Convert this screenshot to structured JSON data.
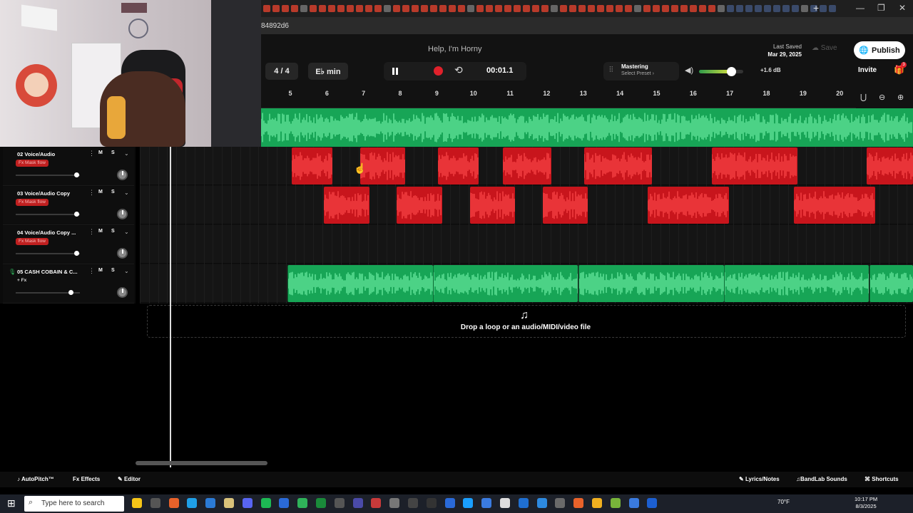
{
  "browser": {
    "url_fragment": "84892d6",
    "new_tab": "+",
    "window_controls": [
      "—",
      "❐",
      "✕"
    ]
  },
  "app": {
    "song_title": "Help, I'm Horny",
    "last_saved_label": "Last Saved",
    "last_saved_date": "Mar 29, 2025",
    "save_label": "Save",
    "publish_label": "Publish",
    "time_signature": "4 / 4",
    "key": "E♭ min",
    "time_display": "00:01.1",
    "mastering_label": "Mastering",
    "mastering_sub": "Select Preset ›",
    "volume_db": "+1.6 dB",
    "volume_level": 0.73,
    "invite_label": "Invite",
    "gift_badge": "3"
  },
  "ruler": {
    "bars": [
      "5",
      "6",
      "7",
      "8",
      "9",
      "10",
      "11",
      "12",
      "13",
      "14",
      "15",
      "16",
      "17",
      "18",
      "19",
      "20"
    ]
  },
  "tracks": [
    {
      "name": "02 Voice/Audio",
      "fx": "Fx  Mask flow",
      "mute": "M",
      "solo": "S",
      "volume": 0.95
    },
    {
      "name": "03 Voice/Audio Copy",
      "fx": "Fx  Mask flow",
      "mute": "M",
      "solo": "S",
      "volume": 0.95
    },
    {
      "name": "04 Voice/Audio Copy ...",
      "fx": "Fx  Mask flow",
      "mute": "M",
      "solo": "S",
      "volume": 0.95
    },
    {
      "name": "05 CASH COBAIN & C...",
      "fx": "+ Fx",
      "mute": "M",
      "solo": "S",
      "volume": 0.86
    }
  ],
  "dropzone": {
    "text": "Drop a loop or an audio/MIDI/video file"
  },
  "bottombar": {
    "autopitch": "AutoPitch™",
    "effects": "Effects",
    "editor": "Editor",
    "lyrics": "Lyrics/Notes",
    "sounds": "BandLab Sounds",
    "shortcuts": "Shortcuts"
  },
  "taskbar": {
    "search_placeholder": "Type here to search",
    "weather": "70°F",
    "time": "10:17 PM",
    "date": "8/3/2025"
  },
  "colors": {
    "clip_red": "#c8151c",
    "clip_green": "#17a556",
    "record": "#e0212b"
  }
}
